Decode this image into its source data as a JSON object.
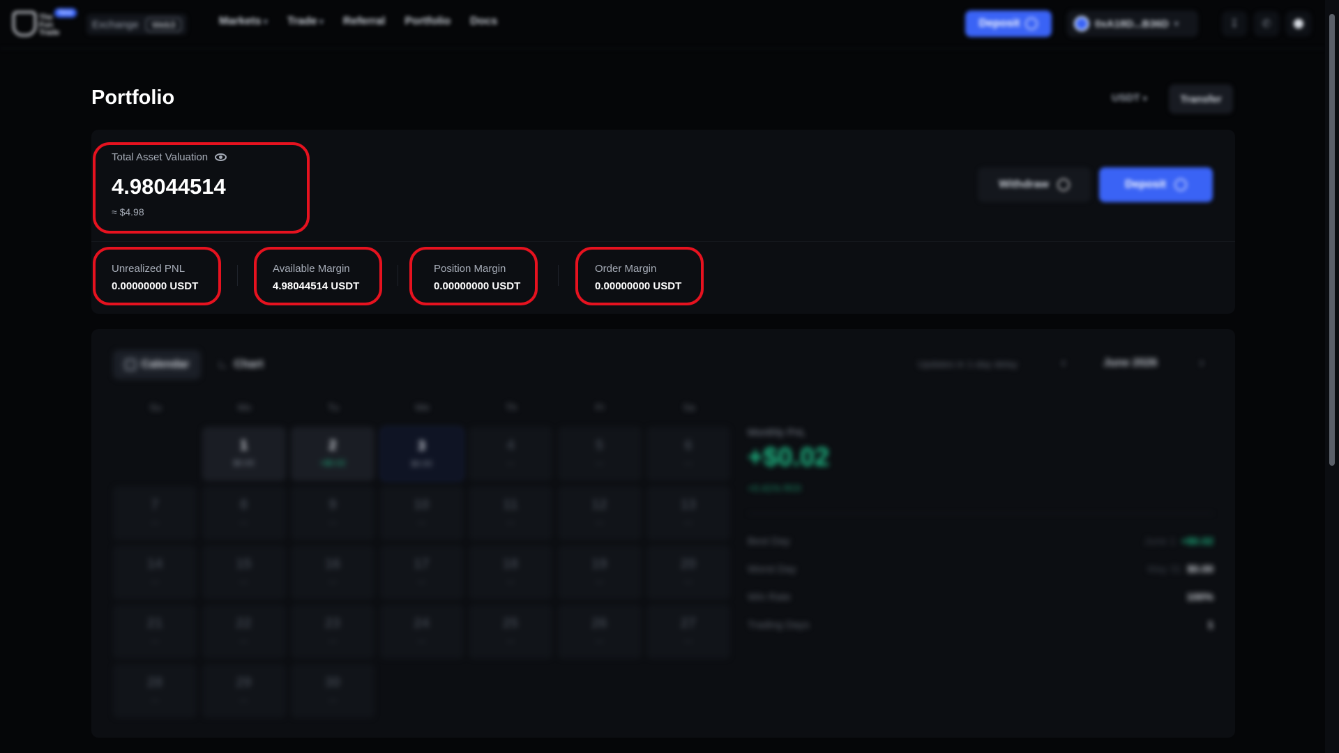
{
  "nav": {
    "logo_text": "The Fun Trade",
    "new_badge": "New",
    "exchange_label": "Exchange",
    "exchange_pill": "Web3",
    "links": [
      "Markets",
      "Trade",
      "Referral",
      "Portfolio",
      "Docs"
    ],
    "deposit_label": "Deposit",
    "wallet_address": "0xA18D...B36D"
  },
  "page": {
    "title": "Portfolio",
    "currency": "USDT",
    "transfer_label": "Transfer"
  },
  "summary": {
    "total_label": "Total Asset Valuation",
    "total_value": "4.98044514",
    "total_usd": "≈ $4.98",
    "withdraw_label": "Withdraw",
    "deposit_label": "Deposit",
    "metrics": [
      {
        "label": "Unrealized PNL",
        "value": "0.00000000 USDT"
      },
      {
        "label": "Available Margin",
        "value": "4.98044514 USDT"
      },
      {
        "label": "Position Margin",
        "value": "0.00000000 USDT"
      },
      {
        "label": "Order Margin",
        "value": "0.00000000 USDT"
      }
    ]
  },
  "calendar": {
    "tab_calendar": "Calendar",
    "tab_chart": "Chart",
    "delay_note": "Updates in 1-day delay",
    "month": "June 2026",
    "weekdays": [
      "Su",
      "Mo",
      "Tu",
      "We",
      "Th",
      "Fr",
      "Sa"
    ],
    "days": [
      {
        "n": "1",
        "p": "$0.00"
      },
      {
        "n": "2",
        "p": "+$0.02"
      },
      {
        "n": "3",
        "p": "$0.00"
      },
      {
        "n": "4",
        "p": "—"
      },
      {
        "n": "5",
        "p": "—"
      },
      {
        "n": "6",
        "p": "—"
      },
      {
        "n": "7",
        "p": "—"
      },
      {
        "n": "8",
        "p": "—"
      },
      {
        "n": "9",
        "p": "—"
      },
      {
        "n": "10",
        "p": "—"
      },
      {
        "n": "11",
        "p": "—"
      },
      {
        "n": "12",
        "p": "—"
      },
      {
        "n": "13",
        "p": "—"
      },
      {
        "n": "14",
        "p": "—"
      },
      {
        "n": "15",
        "p": "—"
      },
      {
        "n": "16",
        "p": "—"
      },
      {
        "n": "17",
        "p": "—"
      },
      {
        "n": "18",
        "p": "—"
      },
      {
        "n": "19",
        "p": "—"
      },
      {
        "n": "20",
        "p": "—"
      },
      {
        "n": "21",
        "p": "—"
      },
      {
        "n": "22",
        "p": "—"
      },
      {
        "n": "23",
        "p": "—"
      },
      {
        "n": "24",
        "p": "—"
      },
      {
        "n": "25",
        "p": "—"
      },
      {
        "n": "26",
        "p": "—"
      },
      {
        "n": "27",
        "p": "—"
      },
      {
        "n": "28",
        "p": "—"
      },
      {
        "n": "29",
        "p": "—"
      },
      {
        "n": "30",
        "p": "—"
      }
    ]
  },
  "monthly": {
    "label": "Monthly PnL",
    "value": "+$0.02",
    "roi": "+0.41% ROI",
    "best_day_label": "Best Day",
    "best_day_date": "June 1",
    "best_day_value": "+$0.02",
    "worst_day_label": "Worst Day",
    "worst_day_date": "May 31",
    "worst_day_value": "$0.00",
    "win_rate_label": "Win Rate",
    "win_rate_value": "100%",
    "trading_days_label": "Trading Days",
    "trading_days_value": "1"
  },
  "colors": {
    "accent": "#3a63f5",
    "positive": "#1db582",
    "highlight": "#e6121f"
  }
}
